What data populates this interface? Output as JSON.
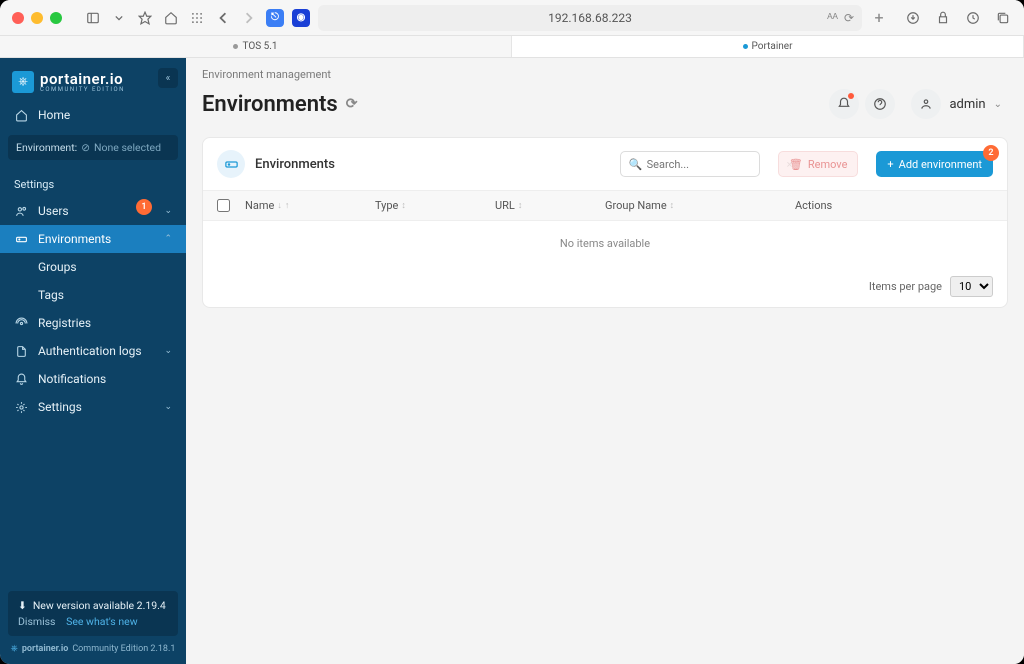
{
  "browser": {
    "url": "192.168.68.223",
    "tab1": "TOS 5.1",
    "tab2": "Portainer"
  },
  "logo": {
    "name": "portainer.io",
    "edition": "COMMUNITY EDITION"
  },
  "nav": {
    "home": "Home",
    "env_label": "Environment:",
    "env_value": "None selected",
    "section": "Settings",
    "users": "Users",
    "users_badge": "1",
    "environments": "Environments",
    "groups": "Groups",
    "tags": "Tags",
    "registries": "Registries",
    "authlogs": "Authentication logs",
    "notifications": "Notifications",
    "settings": "Settings"
  },
  "update": {
    "line1": "New version available 2.19.4",
    "dismiss": "Dismiss",
    "whatsnew": "See what's new"
  },
  "footer": {
    "text": "portainer.io",
    "edition": "Community Edition 2.18.1"
  },
  "header": {
    "breadcrumb": "Environment management",
    "title": "Environments",
    "user": "admin"
  },
  "panel": {
    "title": "Environments",
    "search_placeholder": "Search...",
    "remove": "Remove",
    "add": "Add environment",
    "add_badge": "2"
  },
  "table": {
    "name": "Name",
    "type": "Type",
    "url": "URL",
    "group": "Group Name",
    "actions": "Actions",
    "empty": "No items available",
    "ipp_label": "Items per page",
    "ipp_value": "10"
  }
}
